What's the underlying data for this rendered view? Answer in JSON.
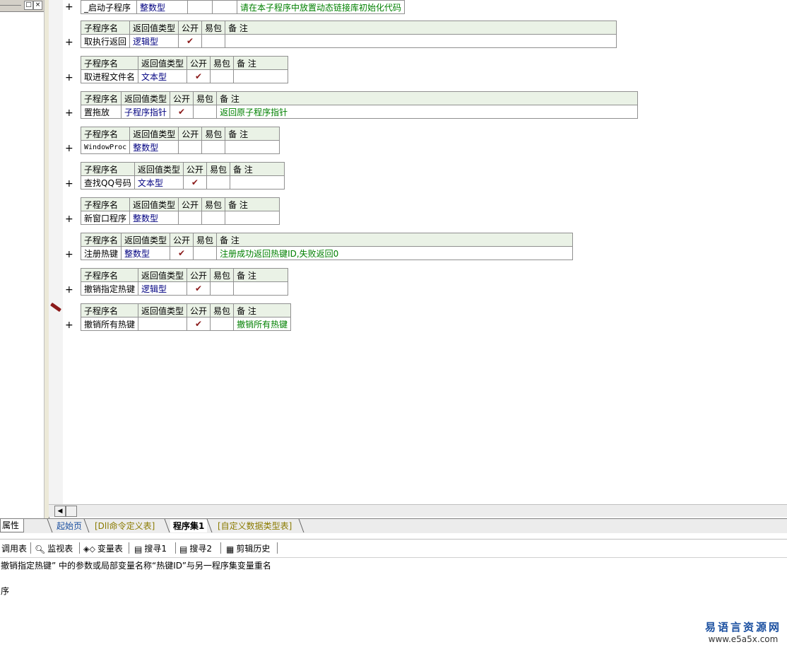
{
  "header_labels": {
    "name": "子程序名",
    "ret": "返回值类型",
    "public": "公开",
    "easy": "易包",
    "remark": "备 注"
  },
  "top_row": {
    "name": "_启动子程序",
    "ret": "整数型",
    "remark": "请在本子程序中放置动态链接库初始化代码"
  },
  "subs": [
    {
      "name": "取执行返回",
      "ret": "逻辑型",
      "public": "✔",
      "remark": ""
    },
    {
      "name": "取进程文件名",
      "ret": "文本型",
      "public": "✔",
      "remark": ""
    },
    {
      "name": "置拖放",
      "ret": "子程序指针",
      "public": "✔",
      "remark": "返回原子程序指针"
    },
    {
      "name": "WindowProc",
      "ret": "整数型",
      "public": "",
      "remark": ""
    },
    {
      "name": "查找QQ号码",
      "ret": "文本型",
      "public": "✔",
      "remark": ""
    },
    {
      "name": "新窗口程序",
      "ret": "整数型",
      "public": "",
      "remark": ""
    },
    {
      "name": "注册热键",
      "ret": "整数型",
      "public": "✔",
      "remark": "注册成功返回热键ID,失败返回0"
    },
    {
      "name": "撤销指定热键",
      "ret": "逻辑型",
      "public": "✔",
      "remark": ""
    },
    {
      "name": "撤销所有热键",
      "ret": "",
      "public": "✔",
      "remark": "撤销所有热键"
    }
  ],
  "plus_symbol": "+",
  "tabs": {
    "prop": "属性",
    "start": "起始页",
    "dll": "[Dll命令定义表]",
    "progset": "程序集1",
    "custom": "[自定义数据类型表]"
  },
  "toolbar": {
    "calls": "调用表",
    "monitor": "监视表",
    "vars": "变量表",
    "search1": "搜寻1",
    "search2": "搜寻2",
    "clip": "剪辑历史"
  },
  "output": {
    "line1": "撤销指定热键” 中的参数或局部变量名称“热键ID”与另一程序集变量重名",
    "line2": "序"
  },
  "watermark": {
    "title": "易语言资源网",
    "url": "www.e5a5x.com"
  },
  "colors": {
    "type": "#000080",
    "remark": "#008000",
    "check": "#8b1a1a",
    "header_bg": "#eaf2e6"
  }
}
